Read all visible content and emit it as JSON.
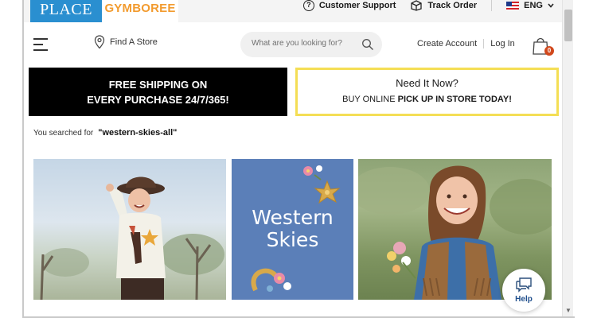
{
  "topbar": {
    "brand_primary": "PLACE",
    "brand_secondary": "GYMBOREE",
    "customer_support": "Customer Support",
    "track_order": "Track Order",
    "language": "ENG"
  },
  "header": {
    "find_store": "Find A Store",
    "search_placeholder": "What are you looking for?",
    "create_account": "Create Account",
    "log_in": "Log In",
    "bag_count": "0"
  },
  "promos": {
    "left_line1": "FREE SHIPPING ON",
    "left_line2": "EVERY PURCHASE 24/7/365!",
    "right_line1": "Need It Now?",
    "right_line2_prefix": "BUY ONLINE",
    "right_line2_bold": "PICK UP IN STORE TODAY!"
  },
  "search_result": {
    "label": "You searched for",
    "term": "\"western-skies-all\""
  },
  "tiles": {
    "middle_title_line1": "Western",
    "middle_title_line2": "Skies"
  },
  "help": {
    "label": "Help"
  },
  "colors": {
    "brand_blue": "#2a8fd0",
    "brand_orange": "#f29b2f",
    "promo_border": "#f4de55",
    "tile_blue": "#5b7fb8",
    "bag_badge": "#d1481c"
  }
}
